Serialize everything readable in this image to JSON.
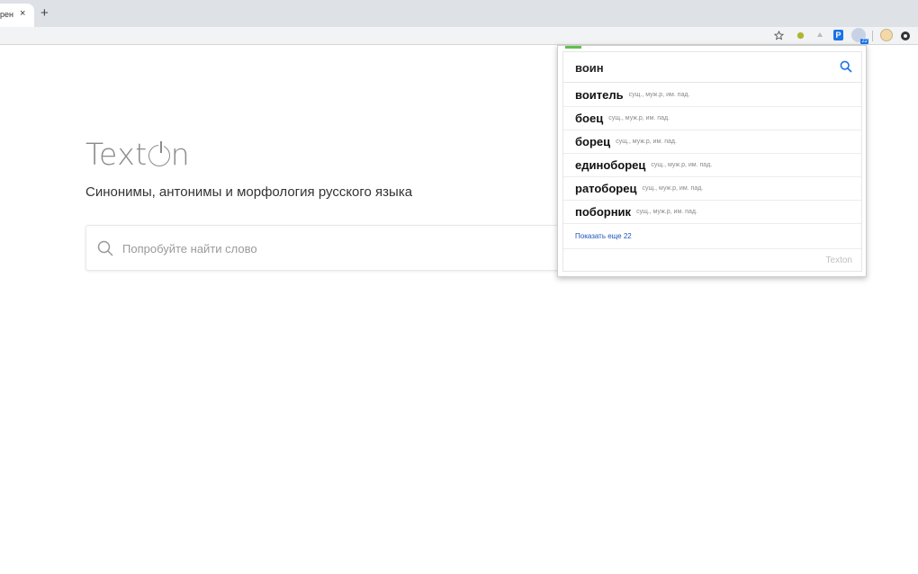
{
  "browser": {
    "tab_title": "рен",
    "tab_close": "×",
    "new_tab": "+",
    "toolbar_icons": [
      "star-icon",
      "extension-icon",
      "download-icon",
      "p-extension-icon",
      "texton-extension-icon",
      "avatar",
      "menu-icon"
    ],
    "ext_p_label": "P",
    "ext_badge": "22"
  },
  "page": {
    "logo": "Texton",
    "subtitle": "Синонимы, антонимы и морфология русского языка",
    "search_placeholder": "Попробуйте найти слово"
  },
  "popup": {
    "query": "воин",
    "results": [
      {
        "word": "воитель",
        "grammar": "сущ., муж.р, им. пад."
      },
      {
        "word": "боец",
        "grammar": "сущ., муж.р, им. пад."
      },
      {
        "word": "борец",
        "grammar": "сущ., муж.р, им. пад."
      },
      {
        "word": "единоборец",
        "grammar": "сущ., муж.р, им. пад."
      },
      {
        "word": "ратоборец",
        "grammar": "сущ., муж.р, им. пад."
      },
      {
        "word": "поборник",
        "grammar": "сущ., муж.р, им. пад."
      }
    ],
    "show_more": "Показать еще 22",
    "footer_logo": "Texton"
  },
  "colors": {
    "accent": "#1a73e8",
    "link": "#1a56b8",
    "top_bar": "#5fbf4f"
  }
}
